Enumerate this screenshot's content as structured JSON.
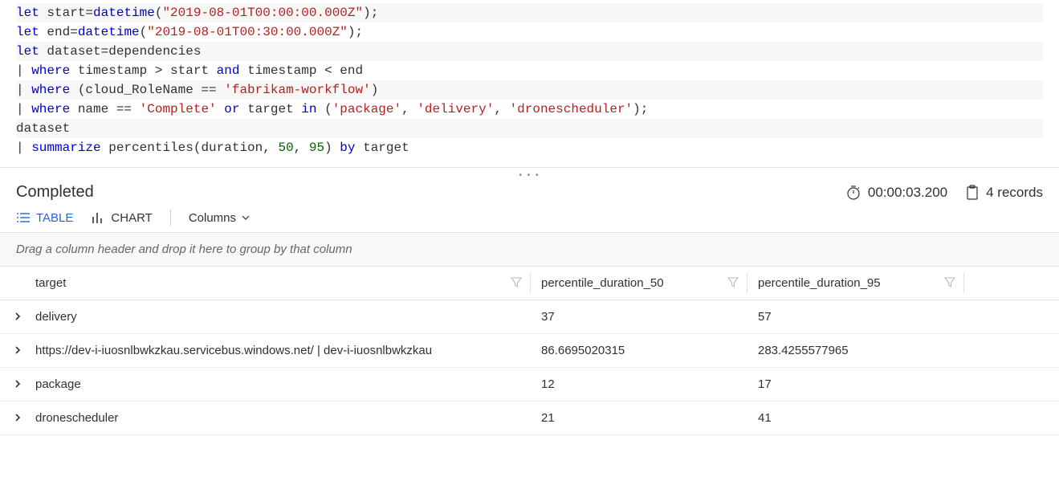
{
  "query": {
    "lines": [
      [
        {
          "t": "kw",
          "v": "let"
        },
        {
          "t": "op",
          "v": " start="
        },
        {
          "t": "fn",
          "v": "datetime"
        },
        {
          "t": "op",
          "v": "("
        },
        {
          "t": "str",
          "v": "\"2019-08-01T00:00:00.000Z\""
        },
        {
          "t": "op",
          "v": ");"
        }
      ],
      [
        {
          "t": "kw",
          "v": "let"
        },
        {
          "t": "op",
          "v": " end="
        },
        {
          "t": "fn",
          "v": "datetime"
        },
        {
          "t": "op",
          "v": "("
        },
        {
          "t": "str",
          "v": "\"2019-08-01T00:30:00.000Z\""
        },
        {
          "t": "op",
          "v": ");"
        }
      ],
      [
        {
          "t": "kw",
          "v": "let"
        },
        {
          "t": "op",
          "v": " dataset=dependencies"
        }
      ],
      [
        {
          "t": "op",
          "v": "| "
        },
        {
          "t": "kw",
          "v": "where"
        },
        {
          "t": "op",
          "v": " timestamp > start "
        },
        {
          "t": "kw",
          "v": "and"
        },
        {
          "t": "op",
          "v": " timestamp < end"
        }
      ],
      [
        {
          "t": "op",
          "v": "| "
        },
        {
          "t": "kw",
          "v": "where"
        },
        {
          "t": "op",
          "v": " (cloud_RoleName == "
        },
        {
          "t": "str",
          "v": "'fabrikam-workflow'"
        },
        {
          "t": "op",
          "v": ")"
        }
      ],
      [
        {
          "t": "op",
          "v": "| "
        },
        {
          "t": "kw",
          "v": "where"
        },
        {
          "t": "op",
          "v": " name == "
        },
        {
          "t": "str",
          "v": "'Complete'"
        },
        {
          "t": "op",
          "v": " "
        },
        {
          "t": "kw",
          "v": "or"
        },
        {
          "t": "op",
          "v": " target "
        },
        {
          "t": "kw",
          "v": "in"
        },
        {
          "t": "op",
          "v": " ("
        },
        {
          "t": "str",
          "v": "'package'"
        },
        {
          "t": "op",
          "v": ", "
        },
        {
          "t": "str",
          "v": "'delivery'"
        },
        {
          "t": "op",
          "v": ", "
        },
        {
          "t": "str",
          "v": "'dronescheduler'"
        },
        {
          "t": "op",
          "v": ");"
        }
      ],
      [
        {
          "t": "op",
          "v": "dataset"
        }
      ],
      [
        {
          "t": "op",
          "v": "| "
        },
        {
          "t": "kw",
          "v": "summarize"
        },
        {
          "t": "op",
          "v": " percentiles(duration, "
        },
        {
          "t": "num",
          "v": "50"
        },
        {
          "t": "op",
          "v": ", "
        },
        {
          "t": "num",
          "v": "95"
        },
        {
          "t": "op",
          "v": ") "
        },
        {
          "t": "kw",
          "v": "by"
        },
        {
          "t": "op",
          "v": " target"
        }
      ]
    ]
  },
  "status": {
    "text": "Completed",
    "duration": "00:00:03.200",
    "records": "4 records"
  },
  "tabs": {
    "table": "TABLE",
    "chart": "CHART",
    "columns": "Columns"
  },
  "group_hint": "Drag a column header and drop it here to group by that column",
  "columns": {
    "target": "target",
    "p50": "percentile_duration_50",
    "p95": "percentile_duration_95"
  },
  "rows": [
    {
      "target": "delivery",
      "p50": "37",
      "p95": "57"
    },
    {
      "target": "https://dev-i-iuosnlbwkzkau.servicebus.windows.net/ | dev-i-iuosnlbwkzkau",
      "p50": "86.6695020315",
      "p95": "283.4255577965"
    },
    {
      "target": "package",
      "p50": "12",
      "p95": "17"
    },
    {
      "target": "dronescheduler",
      "p50": "21",
      "p95": "41"
    }
  ]
}
